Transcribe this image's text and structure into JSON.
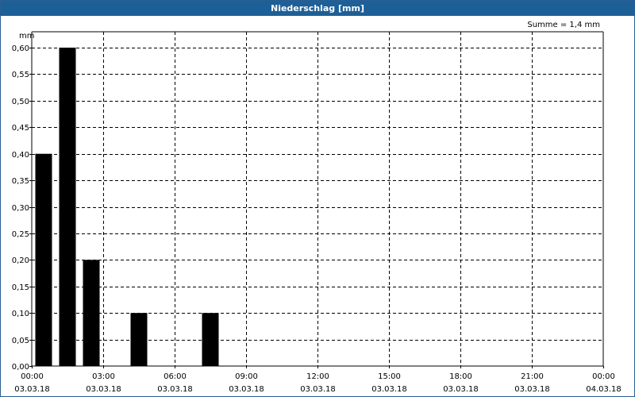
{
  "window": {
    "title": "Niederschlag [mm]"
  },
  "colors": {
    "titlebar": "#1d5f97",
    "bar": "#000000",
    "grid": "#000000"
  },
  "chart_data": {
    "type": "bar",
    "title": "Niederschlag [mm]",
    "ylabel": "mm",
    "xlabel": "",
    "annotation": "Summe = 1,4 mm",
    "ylim": [
      0,
      0.63
    ],
    "yticks": [
      "0,00",
      "0,05",
      "0,10",
      "0,15",
      "0,20",
      "0,25",
      "0,30",
      "0,35",
      "0,40",
      "0,45",
      "0,50",
      "0,55",
      "0,60"
    ],
    "xlim_hours": [
      0,
      24
    ],
    "xticks": [
      {
        "time": "00:00",
        "date": "03.03.18"
      },
      {
        "time": "03:00",
        "date": "03.03.18"
      },
      {
        "time": "06:00",
        "date": "03.03.18"
      },
      {
        "time": "09:00",
        "date": "03.03.18"
      },
      {
        "time": "12:00",
        "date": "03.03.18"
      },
      {
        "time": "15:00",
        "date": "03.03.18"
      },
      {
        "time": "18:00",
        "date": "03.03.18"
      },
      {
        "time": "21:00",
        "date": "03.03.18"
      },
      {
        "time": "00:00",
        "date": "04.03.18"
      }
    ],
    "bars": [
      {
        "hour": 0.5,
        "value": 0.4
      },
      {
        "hour": 1.5,
        "value": 0.6
      },
      {
        "hour": 2.5,
        "value": 0.2
      },
      {
        "hour": 4.5,
        "value": 0.1
      },
      {
        "hour": 7.5,
        "value": 0.1
      }
    ],
    "grid": true,
    "legend": "none"
  }
}
